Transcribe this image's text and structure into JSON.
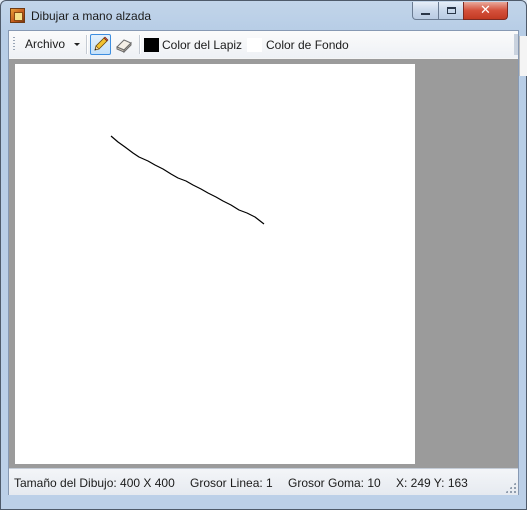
{
  "window": {
    "title": "Dibujar a mano alzada"
  },
  "toolbar": {
    "menu_label": "Archivo",
    "tools": [
      {
        "name": "pencil-tool",
        "icon": "pencil-icon",
        "selected": true
      },
      {
        "name": "eraser-tool",
        "icon": "eraser-icon",
        "selected": false
      }
    ],
    "pen_color_label": "Color del Lapiz",
    "pen_color": "#000000",
    "background_color_label": "Color de Fondo",
    "background_color": "#ffffff"
  },
  "canvas": {
    "background": "#ffffff",
    "workspace_color": "#9b9b9b"
  },
  "status": {
    "size": "Tamaño del Dibujo: 400 X 400",
    "line_width": "Grosor Linea: 1",
    "eraser_width": "Grosor Goma: 10",
    "coords": "X: 249 Y: 163"
  },
  "colors": {
    "accent": "#3d8ee0",
    "stroke": "#000000"
  }
}
